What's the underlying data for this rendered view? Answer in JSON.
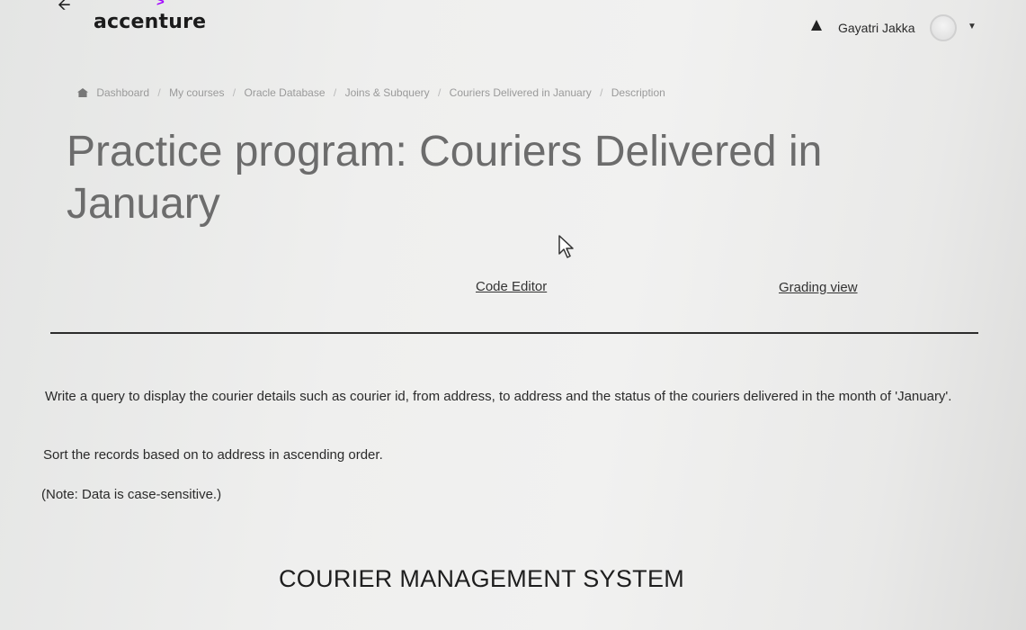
{
  "header": {
    "logo_text": "accenture",
    "logo_mark": ">",
    "user_name": "Gayatri Jakka",
    "icons": [
      "back-arrow-icon",
      "user-icon",
      "avatar",
      "chevron-down-icon"
    ]
  },
  "breadcrumb": [
    "Dashboard",
    "My courses",
    "Oracle Database",
    "Joins & Subquery",
    "Couriers Delivered in January",
    "Description"
  ],
  "page": {
    "title": "Practice program: Couriers Delivered in January"
  },
  "links": {
    "code_editor": "Code Editor",
    "grading_view": "Grading view"
  },
  "description": {
    "line1": "Write a query to display the courier details such as courier id, from address, to address and the status of the couriers delivered in the month of 'January'.",
    "line2": "Sort the records based on to address in ascending order.",
    "line3": "(Note: Data is case-sensitive.)"
  },
  "section_heading": "COURIER MANAGEMENT SYSTEM",
  "colors": {
    "brand_purple": "#a100ff",
    "title_gray": "#6c6c6c",
    "text_dark": "#2a2a2a"
  }
}
